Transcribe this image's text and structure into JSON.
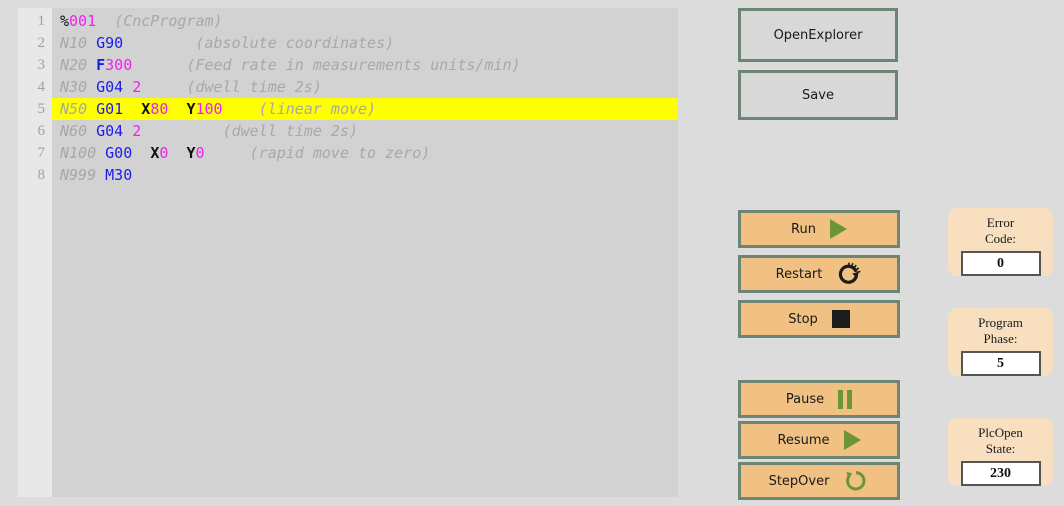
{
  "editor": {
    "line_numbers": [
      "1",
      "2",
      "3",
      "4",
      "5",
      "6",
      "7",
      "8"
    ],
    "highlighted_line": 5,
    "lines": [
      {
        "n": 1,
        "text": "%001    (CncProgram)",
        "tokens": [
          {
            "t": "%",
            "c": "pct"
          },
          {
            "t": "001",
            "c": "num"
          },
          {
            "t": "  ",
            "c": "plain"
          },
          {
            "t": "(CncProgram)",
            "c": "cmt"
          }
        ]
      },
      {
        "n": 2,
        "text": "N10 G90       (absolute coordinates)",
        "tokens": [
          {
            "t": "N10 ",
            "c": "n"
          },
          {
            "t": "G90",
            "c": "g"
          },
          {
            "t": "        ",
            "c": "plain"
          },
          {
            "t": "(absolute coordinates)",
            "c": "cmt"
          }
        ]
      },
      {
        "n": 3,
        "text": "N20 F300      (Feed rate in measurements units/min)",
        "tokens": [
          {
            "t": "N20 ",
            "c": "n"
          },
          {
            "t": "F",
            "c": "gb"
          },
          {
            "t": "300",
            "c": "num"
          },
          {
            "t": "      ",
            "c": "plain"
          },
          {
            "t": "(Feed rate in measurements units/min)",
            "c": "cmt"
          }
        ]
      },
      {
        "n": 4,
        "text": "N30 G04 2     (dwell time 2s)",
        "tokens": [
          {
            "t": "N30 ",
            "c": "n"
          },
          {
            "t": "G04",
            "c": "g"
          },
          {
            "t": " ",
            "c": "plain"
          },
          {
            "t": "2",
            "c": "num"
          },
          {
            "t": "     ",
            "c": "plain"
          },
          {
            "t": "(dwell time 2s)",
            "c": "cmt"
          }
        ]
      },
      {
        "n": 5,
        "text": "N50 G01 X80 Y100   (linear move)",
        "tokens": [
          {
            "t": "N50 ",
            "c": "n"
          },
          {
            "t": "G01",
            "c": "g"
          },
          {
            "t": "  ",
            "c": "plain"
          },
          {
            "t": "X",
            "c": "axis"
          },
          {
            "t": "80",
            "c": "num"
          },
          {
            "t": "  ",
            "c": "plain"
          },
          {
            "t": "Y",
            "c": "axis"
          },
          {
            "t": "100",
            "c": "num"
          },
          {
            "t": "    ",
            "c": "plain"
          },
          {
            "t": "(linear move)",
            "c": "cmt"
          }
        ]
      },
      {
        "n": 6,
        "text": "N60 G04 2         (dwell time 2s)",
        "tokens": [
          {
            "t": "N60 ",
            "c": "n"
          },
          {
            "t": "G04",
            "c": "g"
          },
          {
            "t": " ",
            "c": "plain"
          },
          {
            "t": "2",
            "c": "num"
          },
          {
            "t": "         ",
            "c": "plain"
          },
          {
            "t": "(dwell time 2s)",
            "c": "cmt"
          }
        ]
      },
      {
        "n": 7,
        "text": "N100 G00 X0 Y0     (rapid move to zero)",
        "tokens": [
          {
            "t": "N100 ",
            "c": "n"
          },
          {
            "t": "G00",
            "c": "g"
          },
          {
            "t": "  ",
            "c": "plain"
          },
          {
            "t": "X",
            "c": "axis"
          },
          {
            "t": "0",
            "c": "num"
          },
          {
            "t": "  ",
            "c": "plain"
          },
          {
            "t": "Y",
            "c": "axis"
          },
          {
            "t": "0",
            "c": "num"
          },
          {
            "t": "     ",
            "c": "plain"
          },
          {
            "t": "(rapid move to zero)",
            "c": "cmt"
          }
        ]
      },
      {
        "n": 8,
        "text": "N999 M30",
        "tokens": [
          {
            "t": "N999 ",
            "c": "n"
          },
          {
            "t": "M30",
            "c": "g"
          }
        ]
      }
    ]
  },
  "file_buttons": {
    "open_explorer": "OpenExplorer",
    "save": "Save"
  },
  "control_buttons": {
    "run": {
      "label": "Run",
      "icon": "play-icon"
    },
    "restart": {
      "label": "Restart",
      "icon": "restart-icon"
    },
    "stop": {
      "label": "Stop",
      "icon": "stop-icon"
    },
    "pause": {
      "label": "Pause",
      "icon": "pause-icon"
    },
    "resume": {
      "label": "Resume",
      "icon": "play-icon"
    },
    "step_over": {
      "label": "StepOver",
      "icon": "step-over-icon"
    }
  },
  "status_panels": [
    {
      "label": "Error\nCode:",
      "value": "0"
    },
    {
      "label": "Program\nPhase:",
      "value": "5"
    },
    {
      "label": "PlcOpen\nState:",
      "value": "230"
    }
  ],
  "colors": {
    "page_background": "#dcdcdc",
    "editor_background": "#d2d2d2",
    "gutter_background": "#e8e8e8",
    "highlight_line": "#ffff00",
    "button_tan": "#f0c183",
    "button_grey": "#d8d8d8",
    "button_border": "#6d8575",
    "panel_background": "#f7dfc0",
    "icon_green": "#6b9637",
    "icon_black": "#1c1c1c",
    "token_gcode": "#1a1aee",
    "token_number": "#ee22ee",
    "token_comment": "#a8a8a8",
    "token_axis": "#111111"
  }
}
